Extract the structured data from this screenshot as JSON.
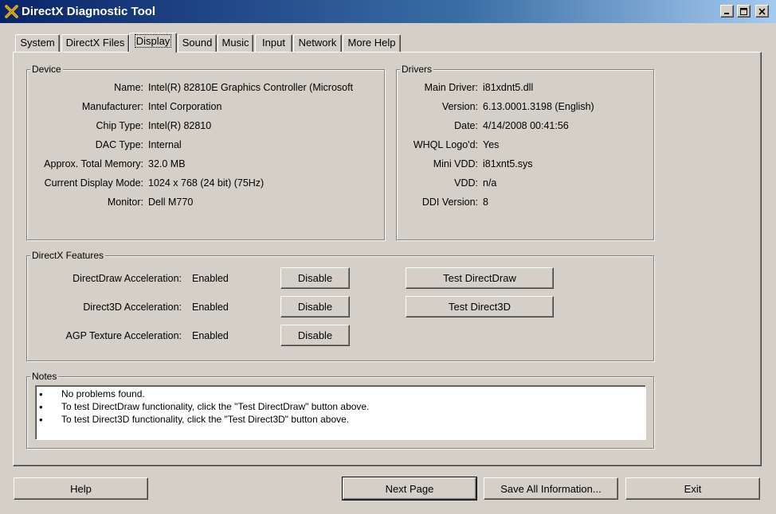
{
  "window": {
    "title": "DirectX Diagnostic Tool"
  },
  "tabs": [
    {
      "label": "System"
    },
    {
      "label": "DirectX Files"
    },
    {
      "label": "Display",
      "active": true
    },
    {
      "label": "Sound"
    },
    {
      "label": "Music"
    },
    {
      "label": "Input"
    },
    {
      "label": "Network"
    },
    {
      "label": "More Help"
    }
  ],
  "device": {
    "title": "Device",
    "rows": [
      {
        "label": "Name:",
        "value": "Intel(R) 82810E Graphics Controller (Microsoft"
      },
      {
        "label": "Manufacturer:",
        "value": "Intel Corporation"
      },
      {
        "label": "Chip Type:",
        "value": "Intel(R) 82810"
      },
      {
        "label": "DAC Type:",
        "value": "Internal"
      },
      {
        "label": "Approx. Total Memory:",
        "value": "32.0 MB"
      },
      {
        "label": "Current Display Mode:",
        "value": "1024 x 768 (24 bit) (75Hz)"
      },
      {
        "label": "Monitor:",
        "value": "Dell M770"
      }
    ]
  },
  "drivers": {
    "title": "Drivers",
    "rows": [
      {
        "label": "Main Driver:",
        "value": "i81xdnt5.dll"
      },
      {
        "label": "Version:",
        "value": "6.13.0001.3198 (English)"
      },
      {
        "label": "Date:",
        "value": "4/14/2008 00:41:56"
      },
      {
        "label": "WHQL Logo'd:",
        "value": "Yes"
      },
      {
        "label": "Mini VDD:",
        "value": "i81xnt5.sys"
      },
      {
        "label": "VDD:",
        "value": "n/a"
      },
      {
        "label": "DDI Version:",
        "value": "8"
      }
    ]
  },
  "features": {
    "title": "DirectX Features",
    "rows": [
      {
        "label": "DirectDraw Acceleration:",
        "status": "Enabled",
        "disable_label": "Disable"
      },
      {
        "label": "Direct3D Acceleration:",
        "status": "Enabled",
        "disable_label": "Disable"
      },
      {
        "label": "AGP Texture Acceleration:",
        "status": "Enabled",
        "disable_label": "Disable"
      }
    ],
    "test_directdraw_label": "Test DirectDraw",
    "test_direct3d_label": "Test Direct3D"
  },
  "notes": {
    "title": "Notes",
    "bullet": "•",
    "items": [
      "No problems found.",
      "To test DirectDraw functionality, click the \"Test DirectDraw\" button above.",
      "To test Direct3D functionality, click the \"Test Direct3D\" button above."
    ]
  },
  "footer": {
    "help_label": "Help",
    "next_page_label": "Next Page",
    "save_label": "Save All Information...",
    "exit_label": "Exit"
  },
  "colors": {
    "titlebar_start": "#0a246a",
    "titlebar_end": "#a6caf0",
    "face": "#d4d0c8"
  },
  "icons": {
    "app": "directx-x-icon",
    "minimize": "minimize-icon",
    "maximize": "maximize-icon",
    "close": "close-icon"
  }
}
